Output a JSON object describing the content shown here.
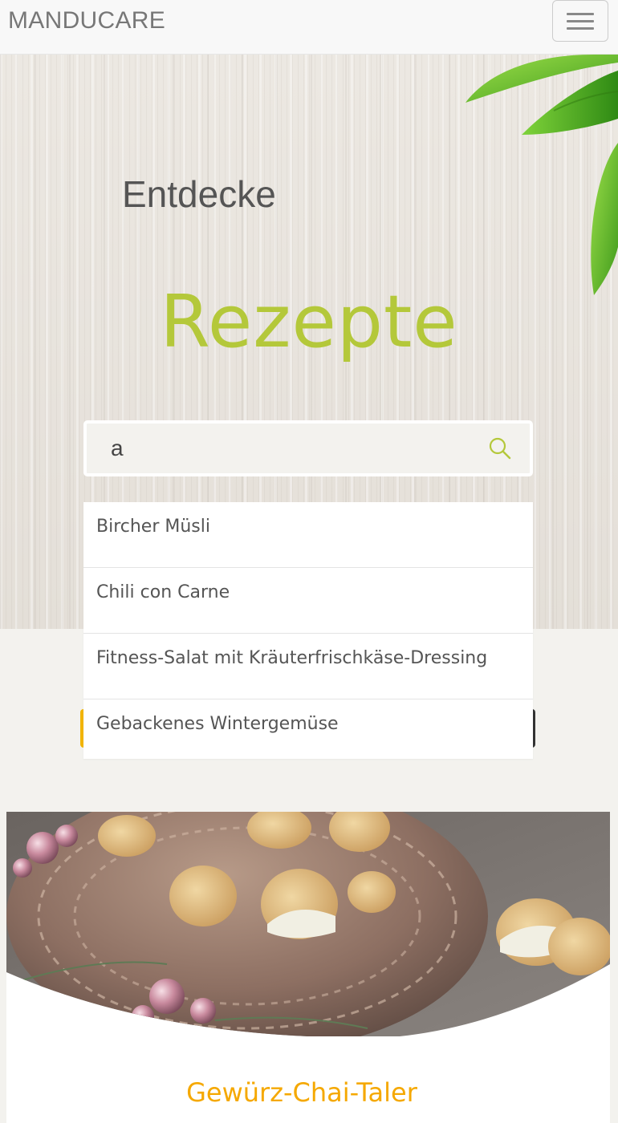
{
  "navbar": {
    "brand": "MANDUCARE",
    "menu_icon": "hamburger-menu-icon"
  },
  "hero": {
    "line1": "Entdecke",
    "line2": "Rezepte",
    "search": {
      "value": "a",
      "icon": "search-icon"
    }
  },
  "suggestions": [
    {
      "label": "Bircher Müsli"
    },
    {
      "label": "Chili con Carne"
    },
    {
      "label": "Fitness-Salat mit Kräuterfrischkäse-Dressing"
    },
    {
      "label": "Gebackenes Wintergemüse"
    }
  ],
  "recipe_card": {
    "title": "Gewürz-Chai-Taler"
  },
  "colors": {
    "accent_green": "#b4c83a",
    "accent_orange": "#f5a800",
    "accent_yellow": "#f2b400",
    "text_gray": "#555555"
  }
}
